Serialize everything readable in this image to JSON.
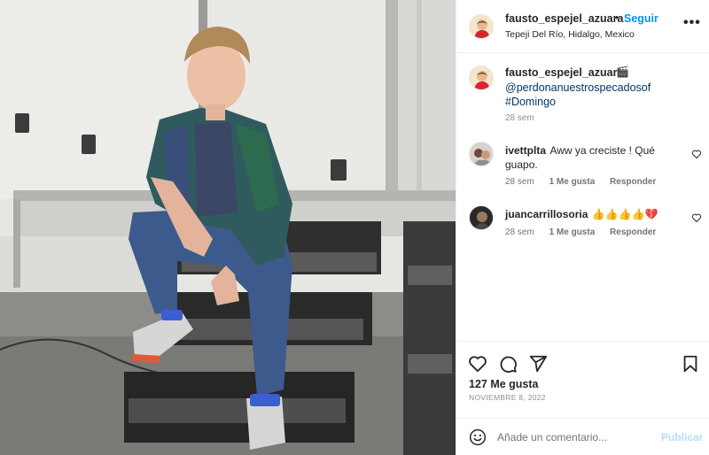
{
  "post": {
    "author": "fausto_espejel_azuara",
    "separator": "•",
    "follow_label": "Seguir",
    "location": "Tepeji Del Río, Hidalgo, Mexico",
    "more_icon": "more-horizontal-icon"
  },
  "caption": {
    "author": "fausto_espejel_azuara",
    "emoji": "🎬",
    "mention": "@perdonanuestrospecadosof",
    "hashtag": "#Domingo",
    "time": "28 sem"
  },
  "comments": [
    {
      "user": "ivettplta",
      "text": "Aww ya creciste ! Qué guapo.",
      "text_line1": "Aww ya creciste ! Qué",
      "text_line2": "guapo.",
      "time": "28 sem",
      "likes": "1 Me gusta",
      "reply": "Responder"
    },
    {
      "user": "juancarrillosoria",
      "text": "👍👍👍👍💔",
      "time": "28 sem",
      "likes": "1 Me gusta",
      "reply": "Responder"
    }
  ],
  "actions": {
    "like_icon": "heart-icon",
    "comment_icon": "comment-icon",
    "share_icon": "share-icon",
    "save_icon": "bookmark-icon"
  },
  "likes_count": "127 Me gusta",
  "date": "NOVIEMBRE 8, 2022",
  "comment_box": {
    "placeholder": "Añade un comentario...",
    "publish_label": "Publicar"
  },
  "colors": {
    "link_blue": "#0095f6",
    "hashtag_blue": "#00376b",
    "publish_disabled": "#b2dffc",
    "muted_gray": "#737373"
  }
}
